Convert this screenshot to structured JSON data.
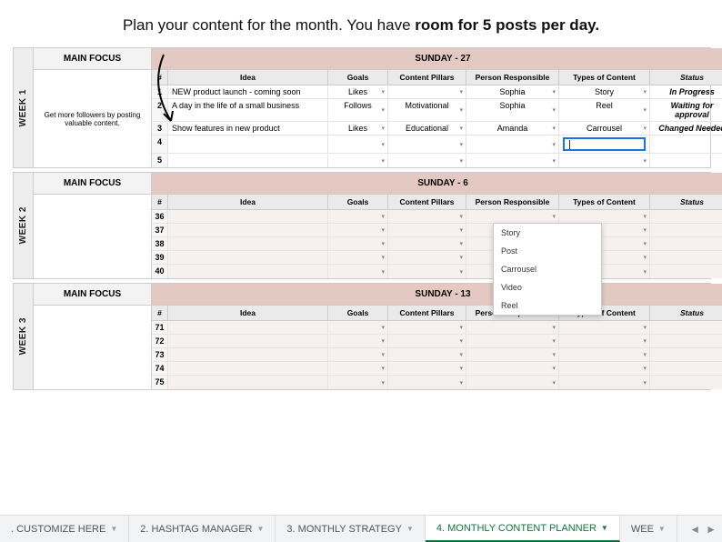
{
  "title_pre": "Plan your content for the month. You have ",
  "title_bold": "room for 5 posts per day.",
  "columns": {
    "num": "#",
    "idea": "Idea",
    "goals": "Goals",
    "pillars": "Content Pillars",
    "person": "Person Responsible",
    "type": "Types of Content",
    "status": "Status"
  },
  "weeks": [
    {
      "label": "WEEK 1",
      "focus_header": "MAIN FOCUS",
      "day_header": "SUNDAY - 27",
      "focus_text": "Get more followers by posting valuable content.",
      "rows": [
        {
          "n": "1",
          "idea": "NEW product launch - coming soon",
          "goals": "Likes",
          "pillars": "",
          "person": "Sophia",
          "type": "Story",
          "status": "In Progress"
        },
        {
          "n": "2",
          "idea": "A day in the life of a small business",
          "goals": "Follows",
          "pillars": "Motivational",
          "person": "Sophia",
          "type": "Reel",
          "status": "Waiting for approval"
        },
        {
          "n": "3",
          "idea": "Show features in new product",
          "goals": "Likes",
          "pillars": "Educational",
          "person": "Amanda",
          "type": "Carrousel",
          "status": "Changed Needed"
        },
        {
          "n": "4",
          "idea": "",
          "goals": "",
          "pillars": "",
          "person": "",
          "type": "_active",
          "status": ""
        },
        {
          "n": "5",
          "idea": "",
          "goals": "",
          "pillars": "",
          "person": "",
          "type": "",
          "status": ""
        }
      ]
    },
    {
      "label": "WEEK 2",
      "focus_header": "MAIN FOCUS",
      "day_header": "SUNDAY - 6",
      "focus_text": "",
      "rows": [
        {
          "n": "36",
          "idea": "",
          "goals": "",
          "pillars": "",
          "person": "",
          "type": "",
          "status": ""
        },
        {
          "n": "37",
          "idea": "",
          "goals": "",
          "pillars": "",
          "person": "",
          "type": "",
          "status": ""
        },
        {
          "n": "38",
          "idea": "",
          "goals": "",
          "pillars": "",
          "person": "",
          "type": "",
          "status": ""
        },
        {
          "n": "39",
          "idea": "",
          "goals": "",
          "pillars": "",
          "person": "",
          "type": "",
          "status": ""
        },
        {
          "n": "40",
          "idea": "",
          "goals": "",
          "pillars": "",
          "person": "",
          "type": "",
          "status": ""
        }
      ]
    },
    {
      "label": "WEEK 3",
      "focus_header": "MAIN FOCUS",
      "day_header": "SUNDAY - 13",
      "focus_text": "",
      "rows": [
        {
          "n": "71",
          "idea": "",
          "goals": "",
          "pillars": "",
          "person": "",
          "type": "",
          "status": ""
        },
        {
          "n": "72",
          "idea": "",
          "goals": "",
          "pillars": "",
          "person": "",
          "type": "",
          "status": ""
        },
        {
          "n": "73",
          "idea": "",
          "goals": "",
          "pillars": "",
          "person": "",
          "type": "",
          "status": ""
        },
        {
          "n": "74",
          "idea": "",
          "goals": "",
          "pillars": "",
          "person": "",
          "type": "",
          "status": ""
        },
        {
          "n": "75",
          "idea": "",
          "goals": "",
          "pillars": "",
          "person": "",
          "type": "",
          "status": ""
        }
      ]
    }
  ],
  "dropdown_options": [
    "Story",
    "Post",
    "Carrousel",
    "Video",
    "Reel"
  ],
  "tabs": [
    {
      "label": ". CUSTOMIZE HERE",
      "active": false
    },
    {
      "label": "2. HASHTAG MANAGER",
      "active": false
    },
    {
      "label": "3. MONTHLY STRATEGY",
      "active": false
    },
    {
      "label": "4. MONTHLY CONTENT PLANNER",
      "active": true
    },
    {
      "label": "WEE",
      "active": false
    }
  ]
}
